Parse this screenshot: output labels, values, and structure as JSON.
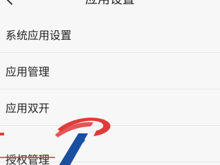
{
  "header": {
    "back_icon": "chevron-left-icon",
    "title": "应用设置"
  },
  "list": {
    "items": [
      {
        "label": "系统应用设置"
      },
      {
        "label": "应用管理"
      },
      {
        "label": "应用双开"
      },
      {
        "label": "授权管理"
      }
    ]
  },
  "colors": {
    "background": "#f7f7f7",
    "divider": "#e6e6e6",
    "text": "#222222",
    "watermark_red": "#e23a3a",
    "watermark_blue": "#1a4fa0"
  },
  "watermark": {
    "icon": "logo-watermark-icon"
  }
}
